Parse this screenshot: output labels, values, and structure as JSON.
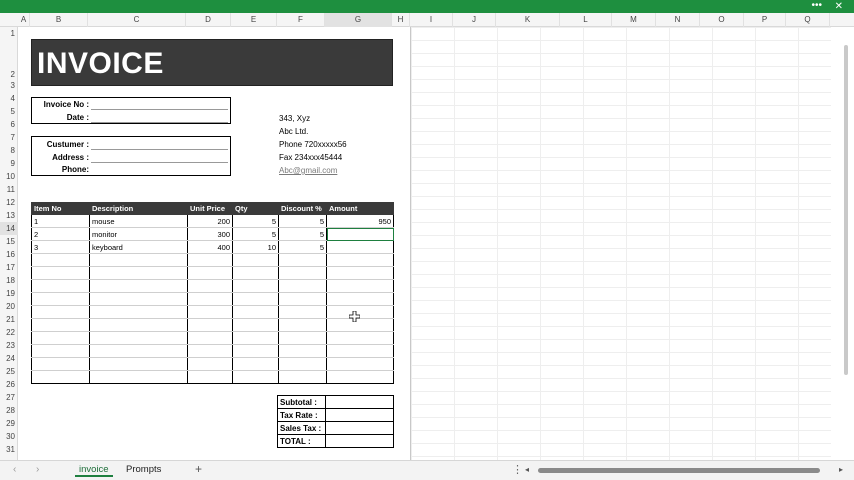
{
  "window": {
    "more_icon": "more-horizontal-icon",
    "close_icon": "close-icon"
  },
  "columns": [
    "A",
    "B",
    "C",
    "D",
    "E",
    "F",
    "G",
    "H",
    "I",
    "J",
    "K",
    "L",
    "M",
    "N",
    "O",
    "P",
    "Q"
  ],
  "rows": [
    "1",
    "2",
    "3",
    "4",
    "5",
    "6",
    "7",
    "8",
    "9",
    "10",
    "11",
    "12",
    "13",
    "14",
    "15",
    "16",
    "17",
    "18",
    "19",
    "20",
    "21",
    "22",
    "23",
    "24",
    "25",
    "26",
    "27",
    "28",
    "29",
    "30",
    "31"
  ],
  "selected": {
    "column": "G",
    "row": "14"
  },
  "invoice": {
    "title": "INVOICE",
    "fields1": [
      {
        "label": "Invoice No :"
      },
      {
        "label": "Date :"
      }
    ],
    "fields2": [
      {
        "label": "Custumer :"
      },
      {
        "label": "Address :"
      },
      {
        "label": "Phone:"
      }
    ],
    "address": {
      "line1": "343, Xyz",
      "line2": "Abc Ltd.",
      "phone": "Phone 720xxxxx56",
      "fax": "Fax 234xxx45444",
      "email": "Abc@gmail.com"
    },
    "table": {
      "headers": [
        "Item No",
        "Description",
        "Unit Price",
        "Qty",
        "Discount %",
        "Amount"
      ],
      "rows": [
        [
          "1",
          "mouse",
          "200",
          "5",
          "5",
          "950"
        ],
        [
          "2",
          "monitor",
          "300",
          "5",
          "5",
          ""
        ],
        [
          "3",
          "keyboard",
          "400",
          "10",
          "5",
          ""
        ],
        [
          "",
          "",
          "",
          "",
          "",
          ""
        ],
        [
          "",
          "",
          "",
          "",
          "",
          ""
        ],
        [
          "",
          "",
          "",
          "",
          "",
          ""
        ],
        [
          "",
          "",
          "",
          "",
          "",
          ""
        ],
        [
          "",
          "",
          "",
          "",
          "",
          ""
        ],
        [
          "",
          "",
          "",
          "",
          "",
          ""
        ],
        [
          "",
          "",
          "",
          "",
          "",
          ""
        ],
        [
          "",
          "",
          "",
          "",
          "",
          ""
        ],
        [
          "",
          "",
          "",
          "",
          "",
          ""
        ],
        [
          "",
          "",
          "",
          "",
          "",
          ""
        ]
      ]
    },
    "totals": [
      {
        "label": "Subtotal :",
        "value": ""
      },
      {
        "label": "Tax Rate :",
        "value": ""
      },
      {
        "label": "Sales Tax :",
        "value": ""
      },
      {
        "label": "TOTAL :",
        "value": ""
      }
    ]
  },
  "sheets": {
    "tabs": [
      "invoice",
      "Prompts"
    ],
    "active": "invoice"
  },
  "colors": {
    "titlebar": "#1e8f3f",
    "header_fill": "#3a3a3a",
    "accent": "#1e7f3f"
  }
}
